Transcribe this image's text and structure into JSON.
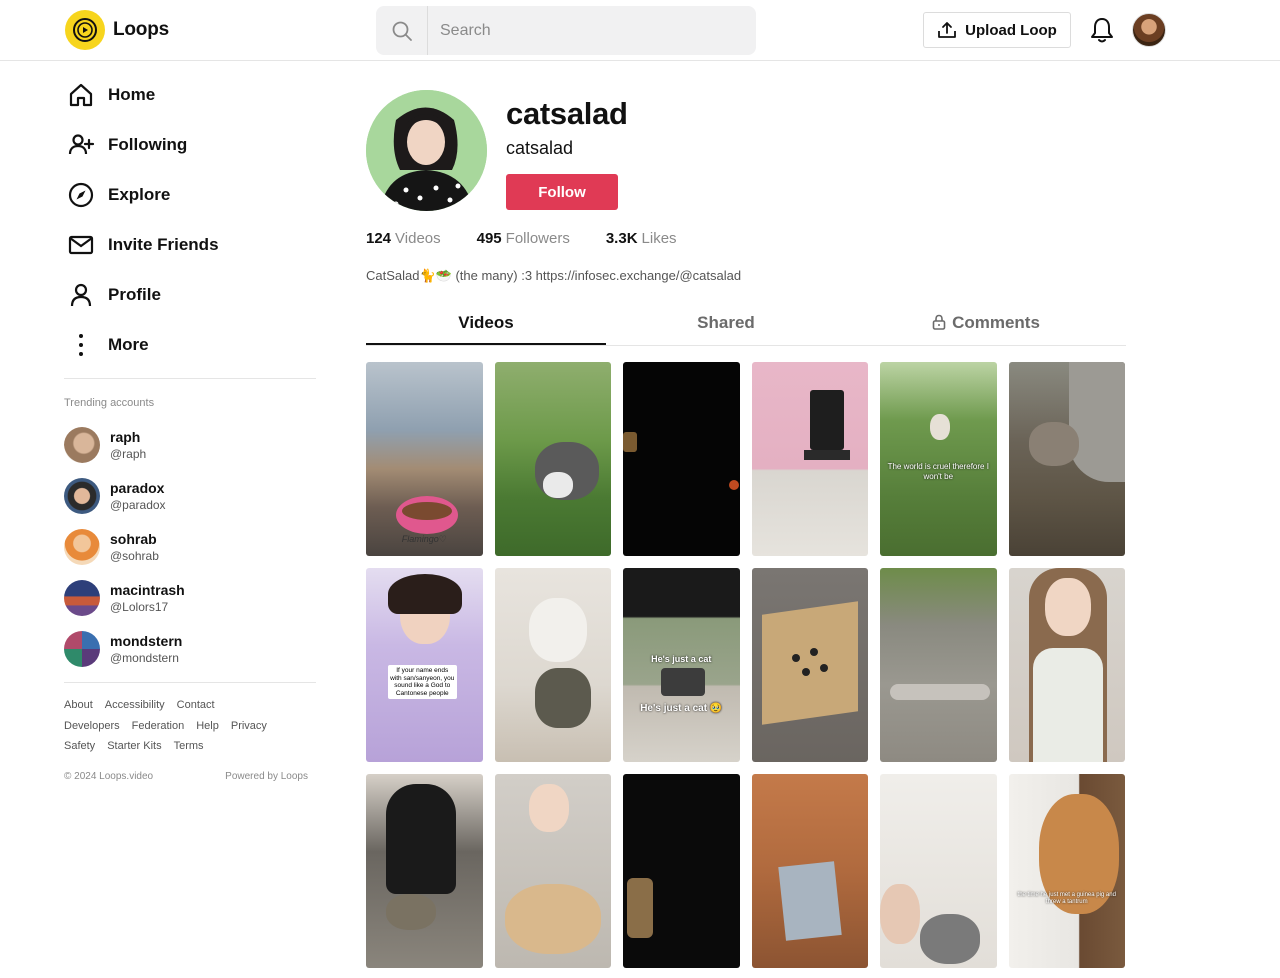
{
  "header": {
    "app_name": "Loops",
    "search_placeholder": "Search",
    "upload_label": "Upload Loop"
  },
  "sidebar": {
    "nav": [
      {
        "label": "Home",
        "icon": "home-icon"
      },
      {
        "label": "Following",
        "icon": "user-plus-icon"
      },
      {
        "label": "Explore",
        "icon": "compass-icon"
      },
      {
        "label": "Invite Friends",
        "icon": "mail-icon"
      },
      {
        "label": "Profile",
        "icon": "user-icon"
      },
      {
        "label": "More",
        "icon": "more-vertical-icon"
      }
    ],
    "trending_title": "Trending accounts",
    "trending": [
      {
        "name": "raph",
        "handle": "@raph"
      },
      {
        "name": "paradox",
        "handle": "@paradox"
      },
      {
        "name": "sohrab",
        "handle": "@sohrab"
      },
      {
        "name": "macintrash",
        "handle": "@Lolors17"
      },
      {
        "name": "mondstern",
        "handle": "@mondstern"
      }
    ],
    "footer_links": [
      "About",
      "Accessibility",
      "Contact",
      "Developers",
      "Federation",
      "Help",
      "Privacy",
      "Safety",
      "Starter Kits",
      "Terms"
    ],
    "copyright": "© 2024 Loops.video",
    "powered_by": "Powered by Loops"
  },
  "profile": {
    "display_name": "catsalad",
    "username": "catsalad",
    "follow_label": "Follow",
    "stats": {
      "videos_count": "124",
      "videos_label": "Videos",
      "followers_count": "495",
      "followers_label": "Followers",
      "likes_count": "3.3K",
      "likes_label": "Likes"
    },
    "bio": "CatSalad🐈🥗 (the many) :3 https://infosec.exchange/@catsalad"
  },
  "tabs": [
    {
      "label": "Videos",
      "active": true
    },
    {
      "label": "Shared",
      "active": false
    },
    {
      "label": "Comments",
      "active": false,
      "icon": "lock-icon"
    }
  ],
  "videos": {
    "captions": {
      "v2": "Flamingo♡",
      "v5": "The world is cruel therefore I won't be",
      "v7": "If your name ends with san/sanyeon, you sound like a God to Cantonese people",
      "v9a": "He's just a cat",
      "v9b": "He's just a cat 🥹",
      "v18": "the time he just met a guinea pig and threw a tantrum"
    }
  },
  "colors": {
    "accent": "#e03a55",
    "logo": "#f7d51d"
  }
}
